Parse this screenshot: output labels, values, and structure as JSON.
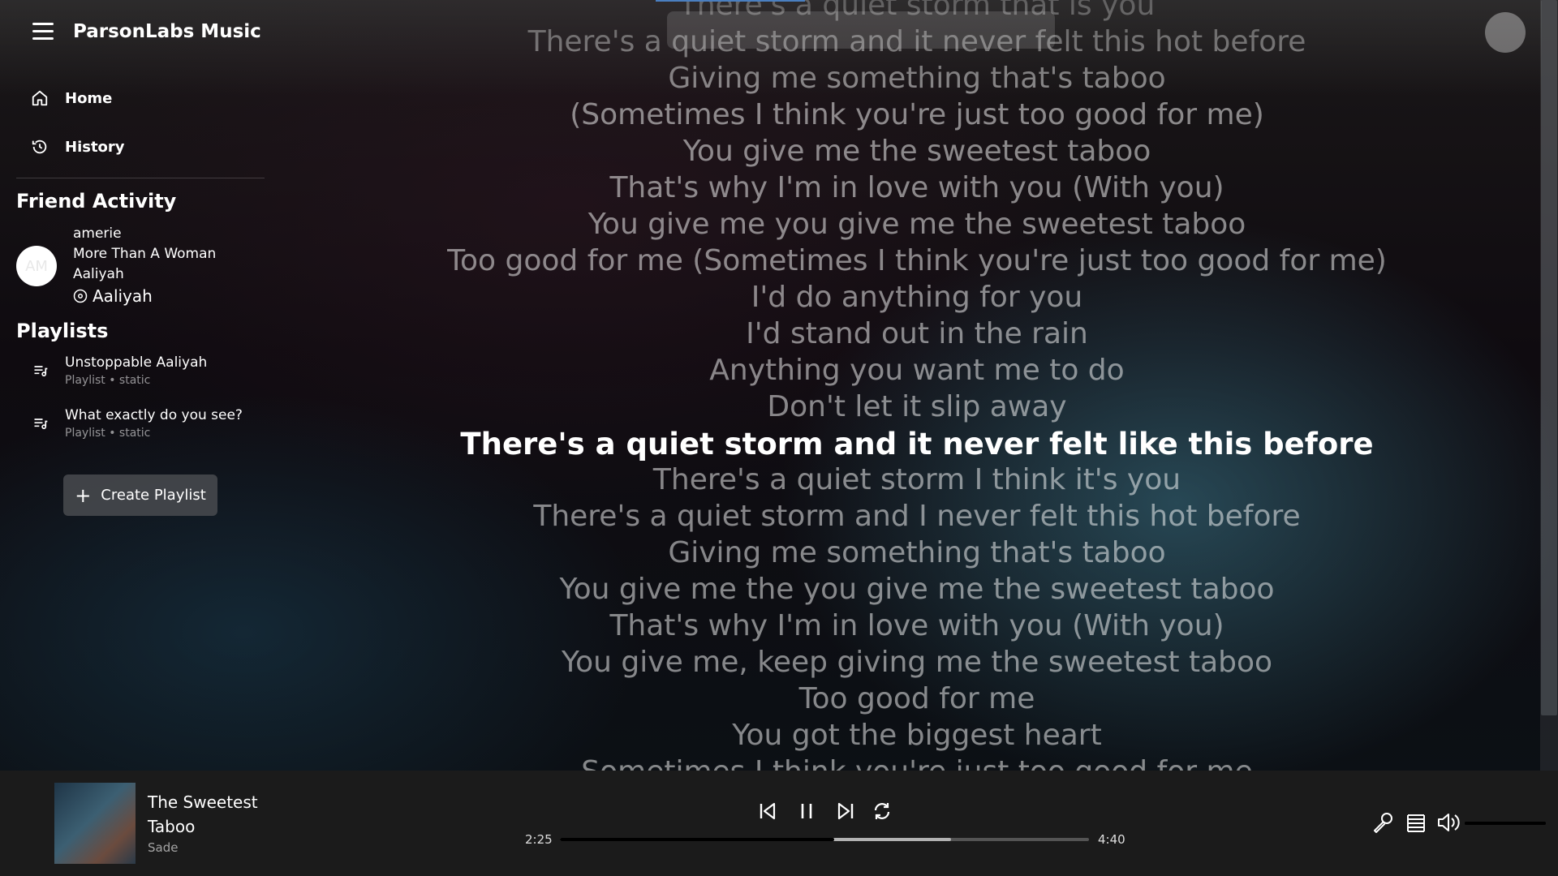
{
  "app": {
    "title": "ParsonLabs Music"
  },
  "nav": [
    {
      "label": "Home",
      "icon": "home-icon"
    },
    {
      "label": "History",
      "icon": "history-icon"
    }
  ],
  "friend_activity": {
    "heading": "Friend Activity",
    "friend": {
      "initials": "AM",
      "username": "amerie",
      "song": "More Than A Woman",
      "song_artist": "Aaliyah",
      "album": "Aaliyah",
      "album_icon": "disc-icon"
    }
  },
  "playlists": {
    "heading": "Playlists",
    "items": [
      {
        "name": "Unstoppable Aaliyah",
        "sub": "Playlist • static",
        "icon": "playlist-icon"
      },
      {
        "name": "What exactly do you see?",
        "sub": "Playlist • static",
        "icon": "playlist-icon"
      }
    ],
    "create_label": "Create Playlist"
  },
  "lyrics": {
    "lines": [
      "There's a quiet storm that is you",
      "There's a quiet storm and it never felt this hot before",
      "Giving me something that's taboo",
      "(Sometimes I think you're just too good for me)",
      "You give me the sweetest taboo",
      "That's why I'm in love with you (With you)",
      "You give me you give me the sweetest taboo",
      "Too good for me (Sometimes I think you're just too good for me)",
      "I'd do anything for you",
      "I'd stand out in the rain",
      "Anything you want me to do",
      "Don't let it slip away",
      "There's a quiet storm and it never felt like this before",
      "There's a quiet storm I think it's you",
      "There's a quiet storm and I never felt this hot before",
      "Giving me something that's taboo",
      "You give me the you give me the sweetest taboo",
      "That's why I'm in love with you (With you)",
      "You give me, keep giving me the sweetest taboo",
      "Too good for me",
      "You got the biggest heart",
      "Sometimes I think you're just too good for me"
    ],
    "active_index": 12
  },
  "player": {
    "track_title": "The Sweetest Taboo",
    "artist": "Sade",
    "elapsed": "2:25",
    "duration": "4:40",
    "progress_fraction": 0.518,
    "buffered_fraction": 0.74,
    "volume_fraction": 1.0
  },
  "colors": {
    "accent": "#4a7fc0",
    "player_bg": "#1b1b1b",
    "button_bg": "#46484c"
  }
}
